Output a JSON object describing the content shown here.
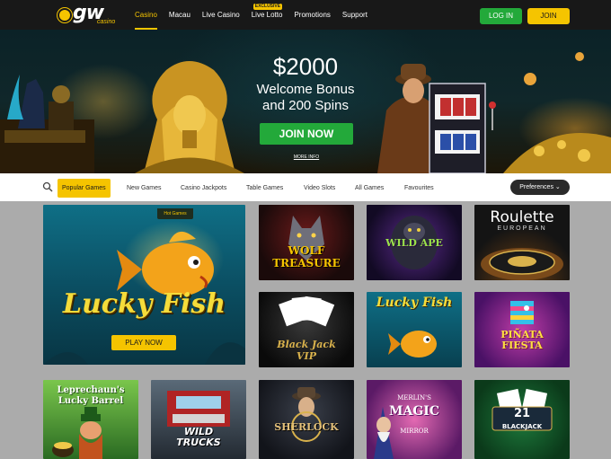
{
  "header": {
    "logo_text": "gw",
    "logo_sub": "casino",
    "nav": [
      {
        "label": "Casino",
        "active": true
      },
      {
        "label": "Macau"
      },
      {
        "label": "Live Casino"
      },
      {
        "label": "Live Lotto",
        "badge": "EXCLUSIVE"
      },
      {
        "label": "Promotions"
      },
      {
        "label": "Support"
      }
    ],
    "login_label": "LOG IN",
    "join_label": "JOIN"
  },
  "hero": {
    "amount": "$2000",
    "line1": "Welcome Bonus",
    "line2": "and 200 Spins",
    "cta": "JOIN NOW",
    "more_info": "MORE INFO"
  },
  "categories": {
    "tabs": [
      "Popular Games",
      "New Games",
      "Casino Jackpots",
      "Table Games",
      "Video Slots",
      "All Games",
      "Favourites"
    ],
    "active_index": 0,
    "preferences_label": "Preferences"
  },
  "featured": {
    "badge": "Hot Games",
    "title": "Lucky Fish",
    "play_label": "PLAY NOW"
  },
  "games": {
    "wolf": {
      "title_line1": "WOLF",
      "title_line2": "TREASURE"
    },
    "ape": {
      "title": "WILD APE"
    },
    "roulette": {
      "title": "Roulette",
      "sub": "EUROPEAN"
    },
    "blackjack_vip": {
      "title_line1": "Black Jack",
      "title_line2": "VIP"
    },
    "lucky_fish": {
      "title": "Lucky Fish"
    },
    "pinata": {
      "title_line1": "PIÑATA",
      "title_line2": "FIESTA"
    },
    "leprechaun": {
      "title_line1": "Leprechaun's",
      "title_line2": "Lucky Barrel"
    },
    "trucks": {
      "title_line1": "WILD",
      "title_line2": "TRUCKS"
    },
    "sherlock": {
      "title": "SHERLOCK"
    },
    "merlin": {
      "pre": "MERLIN'S",
      "title": "MAGIC",
      "post": "MIRROR"
    },
    "blackjack": {
      "num": "21",
      "title": "BLACKJACK"
    }
  },
  "colors": {
    "accent_yellow": "#f5c400",
    "accent_green": "#23a93a",
    "header_bg": "#181818",
    "grid_bg": "#ababab"
  }
}
